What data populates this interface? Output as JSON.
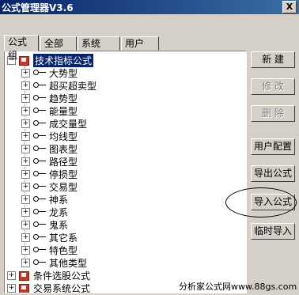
{
  "window": {
    "title": "公式管理器V3.6",
    "close_label": "X"
  },
  "tabs": [
    {
      "label": "公式组",
      "active": true
    },
    {
      "label": "全部",
      "active": false
    },
    {
      "label": "系统",
      "active": false
    },
    {
      "label": "用户",
      "active": false
    }
  ],
  "tree": {
    "root": {
      "label": "技术指标公式",
      "expanded": true,
      "selected": true
    },
    "children": [
      "大势型",
      "超买超卖型",
      "趋势型",
      "能量型",
      "成交量型",
      "均线型",
      "图表型",
      "路径型",
      "停损型",
      "交易型",
      "神系",
      "龙系",
      "鬼系",
      "其它系",
      "特色型",
      "其他类型"
    ],
    "other_roots": [
      "条件选股公式",
      "交易系统公式"
    ]
  },
  "buttons": {
    "new": "新 建",
    "modify": "修 改",
    "delete": "删 除",
    "user_config": "用户配置",
    "export": "导出公式",
    "import": "导入公式",
    "temp_import": "临时导入"
  },
  "watermark": "分析家公式网www.88gs.com"
}
